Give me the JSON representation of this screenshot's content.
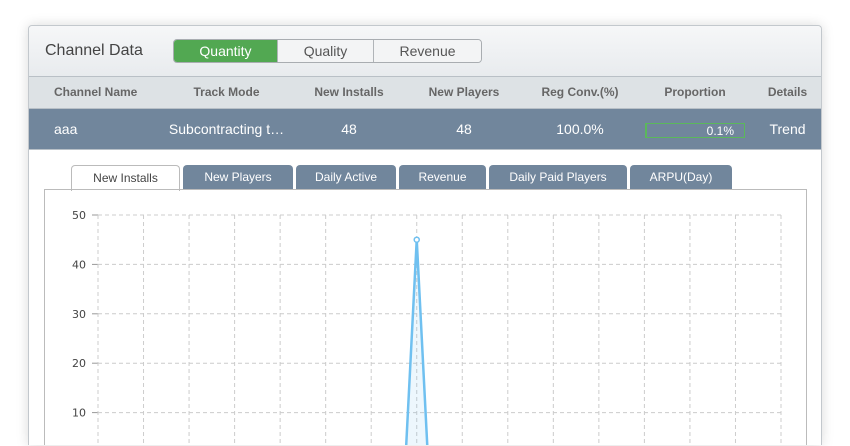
{
  "header": {
    "title": "Channel Data",
    "segments": [
      "Quantity",
      "Quality",
      "Revenue"
    ],
    "active_segment": "Quantity"
  },
  "table": {
    "columns": [
      "Channel Name",
      "Track Mode",
      "New Installs",
      "New Players",
      "Reg Conv.(%)",
      "Proportion",
      "Details"
    ],
    "rows": [
      {
        "channel": "aaa",
        "track_mode": "Subcontracting t…",
        "new_installs": "48",
        "new_players": "48",
        "reg_conv": "100.0%",
        "proportion": "0.1%",
        "proportion_value": 0.001,
        "details": "Trend"
      }
    ]
  },
  "tabs": [
    "New Installs",
    "New Players",
    "Daily Active",
    "Revenue",
    "Daily Paid Players",
    "ARPU(Day)"
  ],
  "colors": {
    "accent": "#52a852",
    "row": "#71869c",
    "line": "#6fc0f0"
  },
  "chart_data": {
    "type": "line",
    "title": "",
    "xlabel": "",
    "ylabel": "",
    "ylim": [
      0,
      50
    ],
    "yticks": [
      "50",
      "40",
      "30",
      "20",
      "10"
    ],
    "grid": true,
    "values": [
      0,
      0,
      0,
      0,
      0,
      0,
      0,
      0,
      0,
      0,
      0,
      0,
      0,
      0,
      0,
      0,
      0,
      0,
      0,
      0,
      0,
      0,
      0,
      0,
      0,
      0,
      0,
      0,
      45,
      0,
      0,
      0,
      0,
      0,
      0,
      0,
      0,
      0,
      0,
      0,
      0,
      0,
      0,
      0,
      0,
      0,
      0,
      0,
      0,
      0,
      0,
      0,
      0,
      0,
      0,
      0,
      0,
      0,
      0,
      0,
      0
    ]
  }
}
